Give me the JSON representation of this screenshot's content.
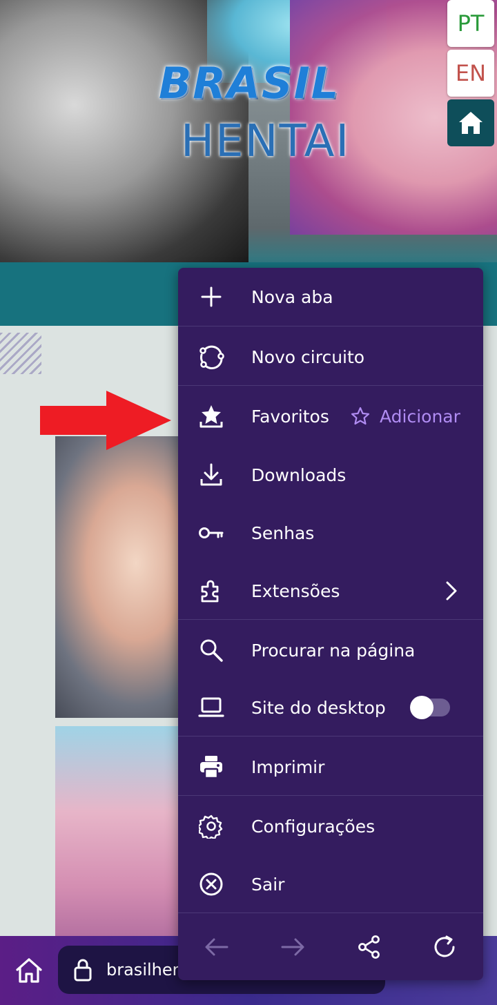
{
  "header": {
    "logo_line1": "BRASIL",
    "logo_line2": "HENTAI",
    "lang_pt": "PT",
    "lang_en": "EN",
    "home_icon": "home-icon"
  },
  "content": {
    "arrow_color": "#ee1c24"
  },
  "menu": {
    "items": [
      {
        "label": "Nova aba",
        "icon": "plus-icon"
      },
      {
        "label": "Novo circuito",
        "icon": "circuit-icon"
      },
      {
        "label": "Favoritos",
        "icon": "bookmark-star-icon",
        "action_label": "Adicionar",
        "action_icon": "star-outline-icon"
      },
      {
        "label": "Downloads",
        "icon": "download-icon"
      },
      {
        "label": "Senhas",
        "icon": "key-icon"
      },
      {
        "label": "Extensões",
        "icon": "puzzle-icon",
        "trailing_icon": "chevron-right-icon"
      },
      {
        "label": "Procurar na página",
        "icon": "search-icon"
      },
      {
        "label": "Site do desktop",
        "icon": "laptop-icon",
        "toggle_on": false
      },
      {
        "label": "Imprimir",
        "icon": "printer-icon"
      },
      {
        "label": "Configurações",
        "icon": "gear-icon"
      },
      {
        "label": "Sair",
        "icon": "close-circle-icon"
      }
    ],
    "nav": [
      "back-arrow-icon",
      "forward-arrow-icon",
      "share-icon",
      "reload-icon"
    ],
    "colors": {
      "background": "#341c5f",
      "accent": "#b08cf2"
    }
  },
  "browser_bar": {
    "url": "brasilhen",
    "home_icon": "home-outline-icon",
    "lock_icon": "lock-icon"
  }
}
